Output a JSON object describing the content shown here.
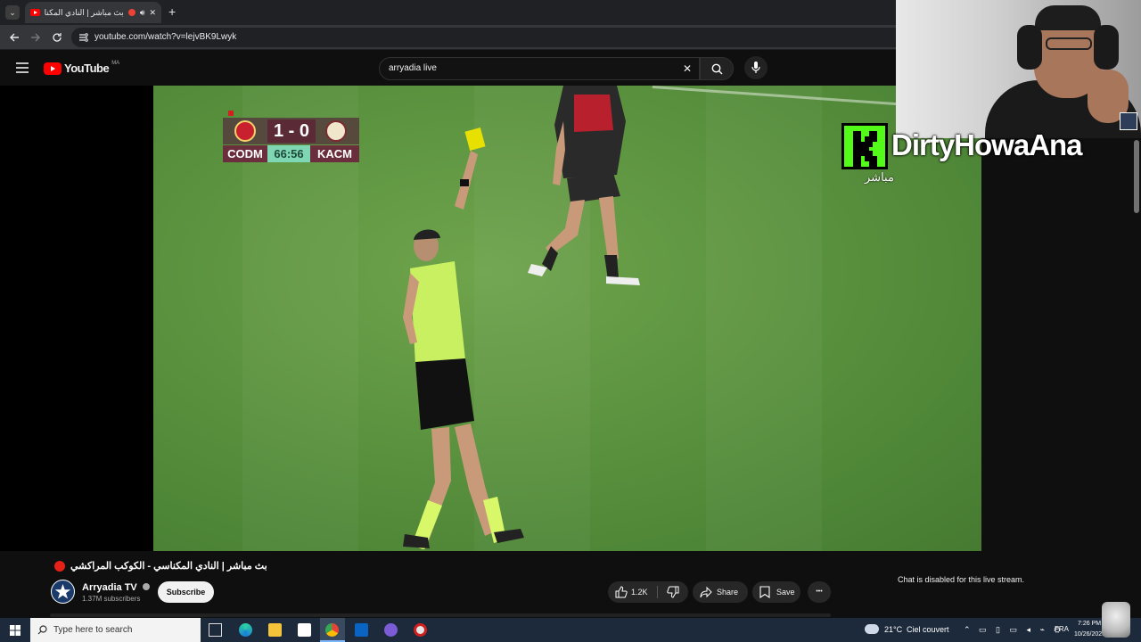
{
  "browser": {
    "tab_title": "بث مباشر | النادي المكنا...",
    "url": "youtube.com/watch?v=lejvBK9Lwyk",
    "new_tab": "+",
    "close_tab": "✕"
  },
  "youtube": {
    "logo_text": "YouTube",
    "region": "MA",
    "search_query": "arryadia live"
  },
  "scoreboard": {
    "score": "1 - 0",
    "home": "CODM",
    "away": "KACM",
    "clock": "66:56"
  },
  "overlay": {
    "streamer_name": "DirtyHowaAna",
    "live_label": "مباشر"
  },
  "video_info": {
    "title": "بث مباشر | النادي المكناسي - الكوكب المراكشي",
    "channel": "Arryadia TV",
    "subscribers": "1.37M subscribers",
    "subscribe": "Subscribe",
    "likes": "1.2K",
    "share": "Share",
    "save": "Save",
    "more": "•••"
  },
  "chat": {
    "disabled_text": "Chat is disabled for this live stream."
  },
  "taskbar": {
    "search_placeholder": "Type here to search",
    "temperature": "21°C",
    "weather": "Ciel couvert",
    "language": "FRA",
    "time": "7:26 PM",
    "date": "10/26/2023"
  },
  "colors": {
    "youtube_red": "#ff0000",
    "kick_green": "#53fc18",
    "pitch_green": "#5d9440"
  }
}
